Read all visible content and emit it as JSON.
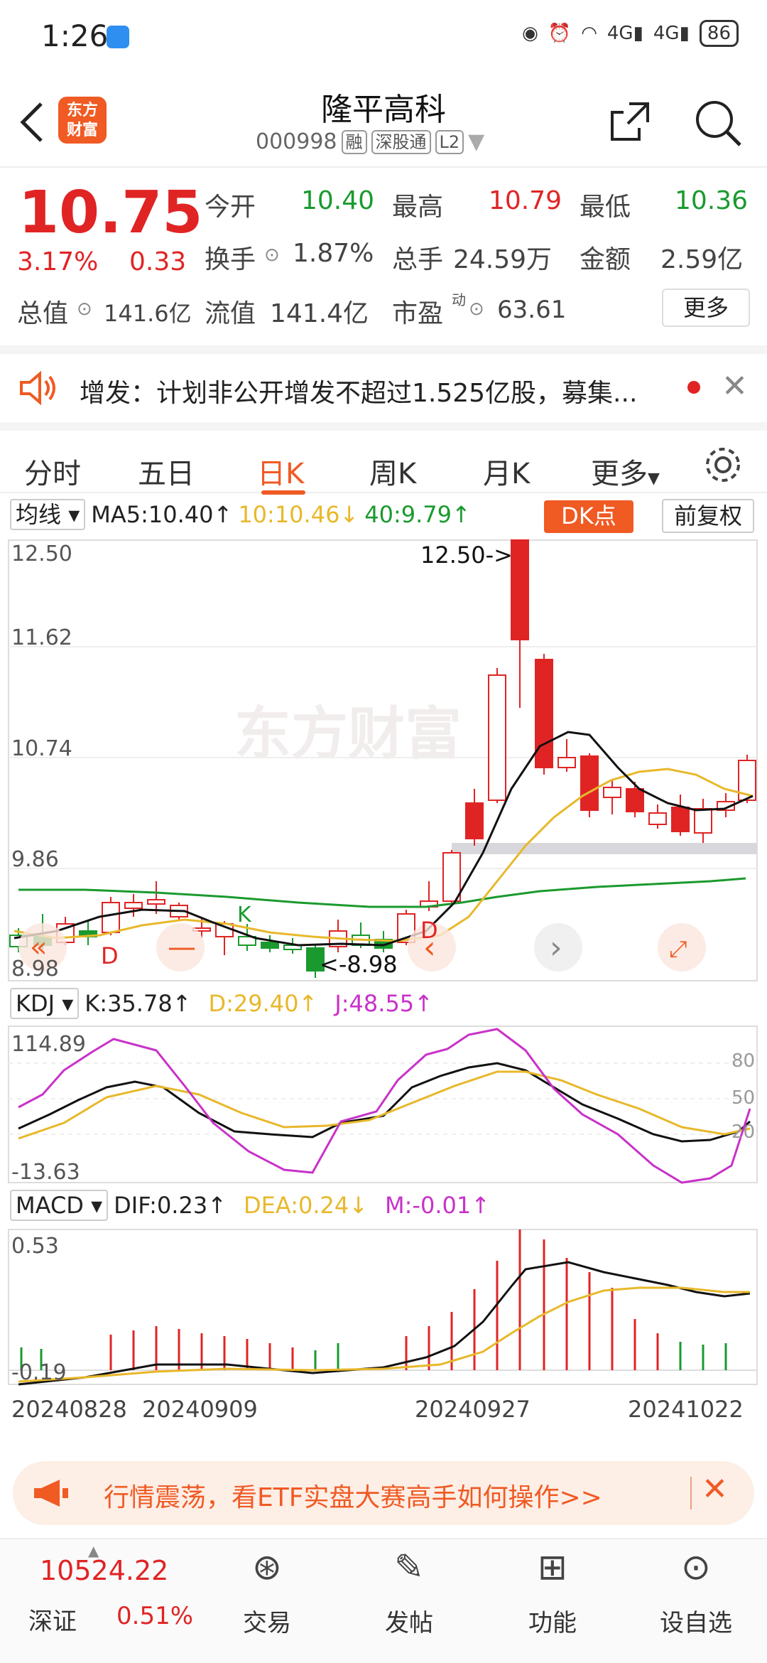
{
  "status_bar": {
    "time": "1:26",
    "signal1": "4G",
    "signal2": "4G",
    "battery": "86"
  },
  "header": {
    "logo_line1": "东方",
    "logo_line2": "财富",
    "title": "隆平高科",
    "code": "000998",
    "tags": [
      "融",
      "深股通",
      "L2"
    ]
  },
  "quote": {
    "price": "10.75",
    "change_pct": "3.17%",
    "change": "0.33",
    "open_label": "今开",
    "open": "10.40",
    "high_label": "最高",
    "high": "10.79",
    "low_label": "最低",
    "low": "10.36",
    "turnover_label": "换手",
    "turnover": "1.87%",
    "volume_label": "总手",
    "volume": "24.59万",
    "amount_label": "金额",
    "amount": "2.59亿",
    "mktcap_label": "总值",
    "mktcap": "141.6亿",
    "float_label": "流值",
    "float": "141.4亿",
    "pe_label": "市盈",
    "pe_sup": "动",
    "pe": "63.61",
    "more": "更多"
  },
  "notice": {
    "text": "增发：计划非公开增发不超过1.525亿股，募集..."
  },
  "tabs": [
    "分时",
    "五日",
    "日K",
    "周K",
    "月K",
    "更多"
  ],
  "active_tab": "日K",
  "kline": {
    "ma_selector": "均线",
    "ma5": "MA5:10.40↑",
    "ma10": "10:10.46↓",
    "ma40": "40:9.79↑",
    "dk": "DK点",
    "fq": "前复权",
    "y_labels": [
      "12.50",
      "11.62",
      "10.74",
      "9.86",
      "8.98"
    ],
    "high_mark": "12.50->",
    "low_mark": "<-8.98",
    "d_letter": "D",
    "k_letter": "K"
  },
  "kdj": {
    "selector": "KDJ",
    "k": "K:35.78↑",
    "d": "D:29.40↑",
    "j": "J:48.55↑",
    "y_top": "114.89",
    "y_bottom": "-13.63",
    "lines": [
      "80",
      "50",
      "20"
    ]
  },
  "macd": {
    "selector": "MACD",
    "dif": "DIF:0.23↑",
    "dea": "DEA:0.24↓",
    "m": "M:-0.01↑",
    "y_top": "0.53",
    "y_bottom": "-0.19"
  },
  "dates": [
    "20240828",
    "20240909",
    "20240927",
    "20241022"
  ],
  "banner": {
    "text": "行情震荡，看ETF实盘大赛高手如何操作>>"
  },
  "bottom_bar": {
    "index_value": "10524.22",
    "index_name": "深证",
    "index_change": "0.51%",
    "items": [
      "交易",
      "发帖",
      "功能",
      "设自选"
    ]
  },
  "colors": {
    "up": "#e02424",
    "down": "#1a9a2e",
    "accent": "#f05a23",
    "ma10": "#e8b82a",
    "ma40": "#1a9a2e",
    "j": "#c832c8"
  }
}
